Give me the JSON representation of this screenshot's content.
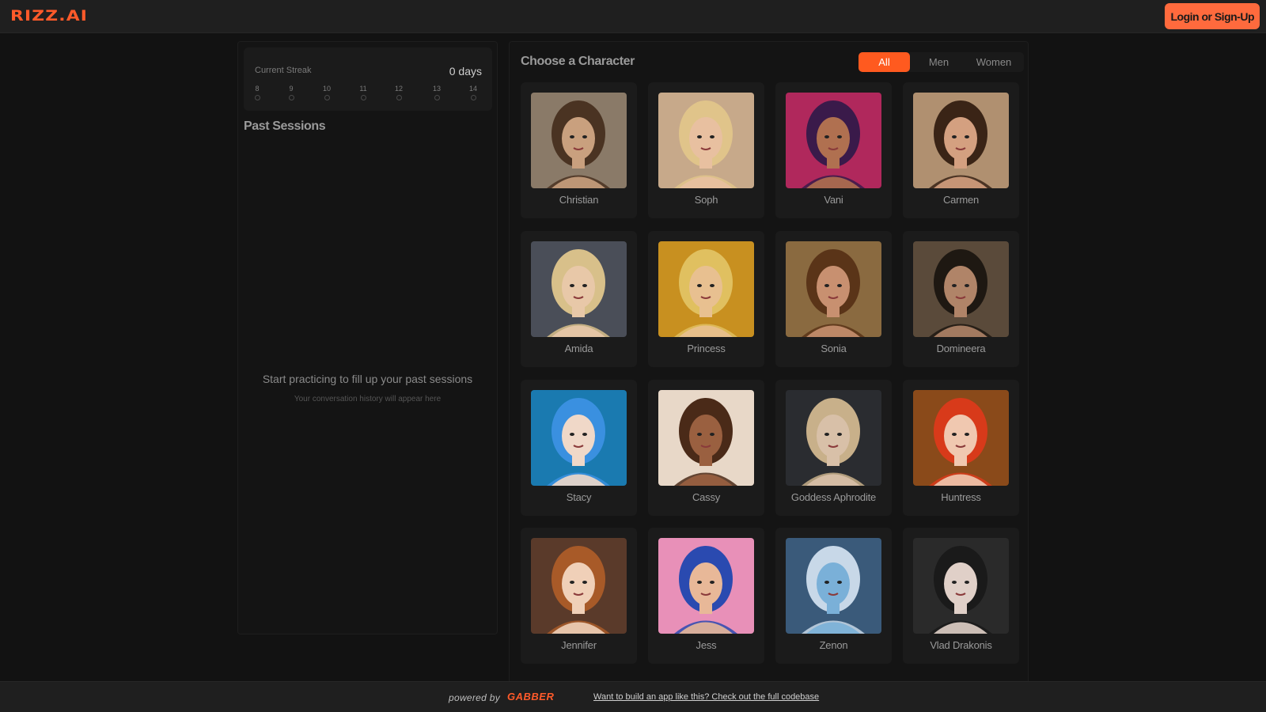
{
  "header": {
    "logo": "RIZZ.AI",
    "login_label": "Login or Sign-Up"
  },
  "streak": {
    "label": "Current Streak",
    "value": "0 days",
    "days": [
      "8",
      "9",
      "10",
      "11",
      "12",
      "13",
      "14"
    ]
  },
  "sessions": {
    "title": "Past Sessions",
    "empty_title": "Start practicing to fill up your past sessions",
    "empty_subtitle": "Your conversation history will appear here"
  },
  "characters_section": {
    "title": "Choose a Character",
    "filters": [
      "All",
      "Men",
      "Women"
    ],
    "active_filter": "All"
  },
  "characters": [
    {
      "name": "Christian",
      "bg": "#8a7a68",
      "skin": "#c9a07e",
      "hair": "#4a3322"
    },
    {
      "name": "Soph",
      "bg": "#c7a98a",
      "skin": "#e8c0a0",
      "hair": "#e0c48a"
    },
    {
      "name": "Vani",
      "bg": "#b0285c",
      "skin": "#b07050",
      "hair": "#3a1a4a"
    },
    {
      "name": "Carmen",
      "bg": "#b09070",
      "skin": "#d4a080",
      "hair": "#3a2416"
    },
    {
      "name": "Amida",
      "bg": "#4a4e58",
      "skin": "#e8c8a8",
      "hair": "#d8c08a"
    },
    {
      "name": "Princess",
      "bg": "#c89020",
      "skin": "#e8c090",
      "hair": "#e0c060"
    },
    {
      "name": "Sonia",
      "bg": "#8a6a40",
      "skin": "#c89070",
      "hair": "#5a3418"
    },
    {
      "name": "Domineera",
      "bg": "#5a4a3a",
      "skin": "#b08468",
      "hair": "#1e1812"
    },
    {
      "name": "Stacy",
      "bg": "#1a7ab0",
      "skin": "#f0d8c8",
      "hair": "#3a90e0"
    },
    {
      "name": "Cassy",
      "bg": "#e8d8c8",
      "skin": "#9a6040",
      "hair": "#4a2a18"
    },
    {
      "name": "Goddess Aphrodite",
      "bg": "#2a2c30",
      "skin": "#d8c0a8",
      "hair": "#c8b08a"
    },
    {
      "name": "Huntress",
      "bg": "#8a4a1a",
      "skin": "#f0c8b0",
      "hair": "#d83a1a"
    },
    {
      "name": "Jennifer",
      "bg": "#5a3a2a",
      "skin": "#f0d0b8",
      "hair": "#a85a28"
    },
    {
      "name": "Jess",
      "bg": "#e890b8",
      "skin": "#e8b898",
      "hair": "#2a4ab0"
    },
    {
      "name": "Zenon",
      "bg": "#3a5a7a",
      "skin": "#7ab0d8",
      "hair": "#c8d8e8"
    },
    {
      "name": "Vlad Drakonis",
      "bg": "#2a2a2a",
      "skin": "#e0d0c8",
      "hair": "#1a1a1a"
    }
  ],
  "footer": {
    "powered_by": "powered by",
    "brand": "GABBER",
    "link_text": "Want to build an app like this? Check out the full codebase"
  }
}
